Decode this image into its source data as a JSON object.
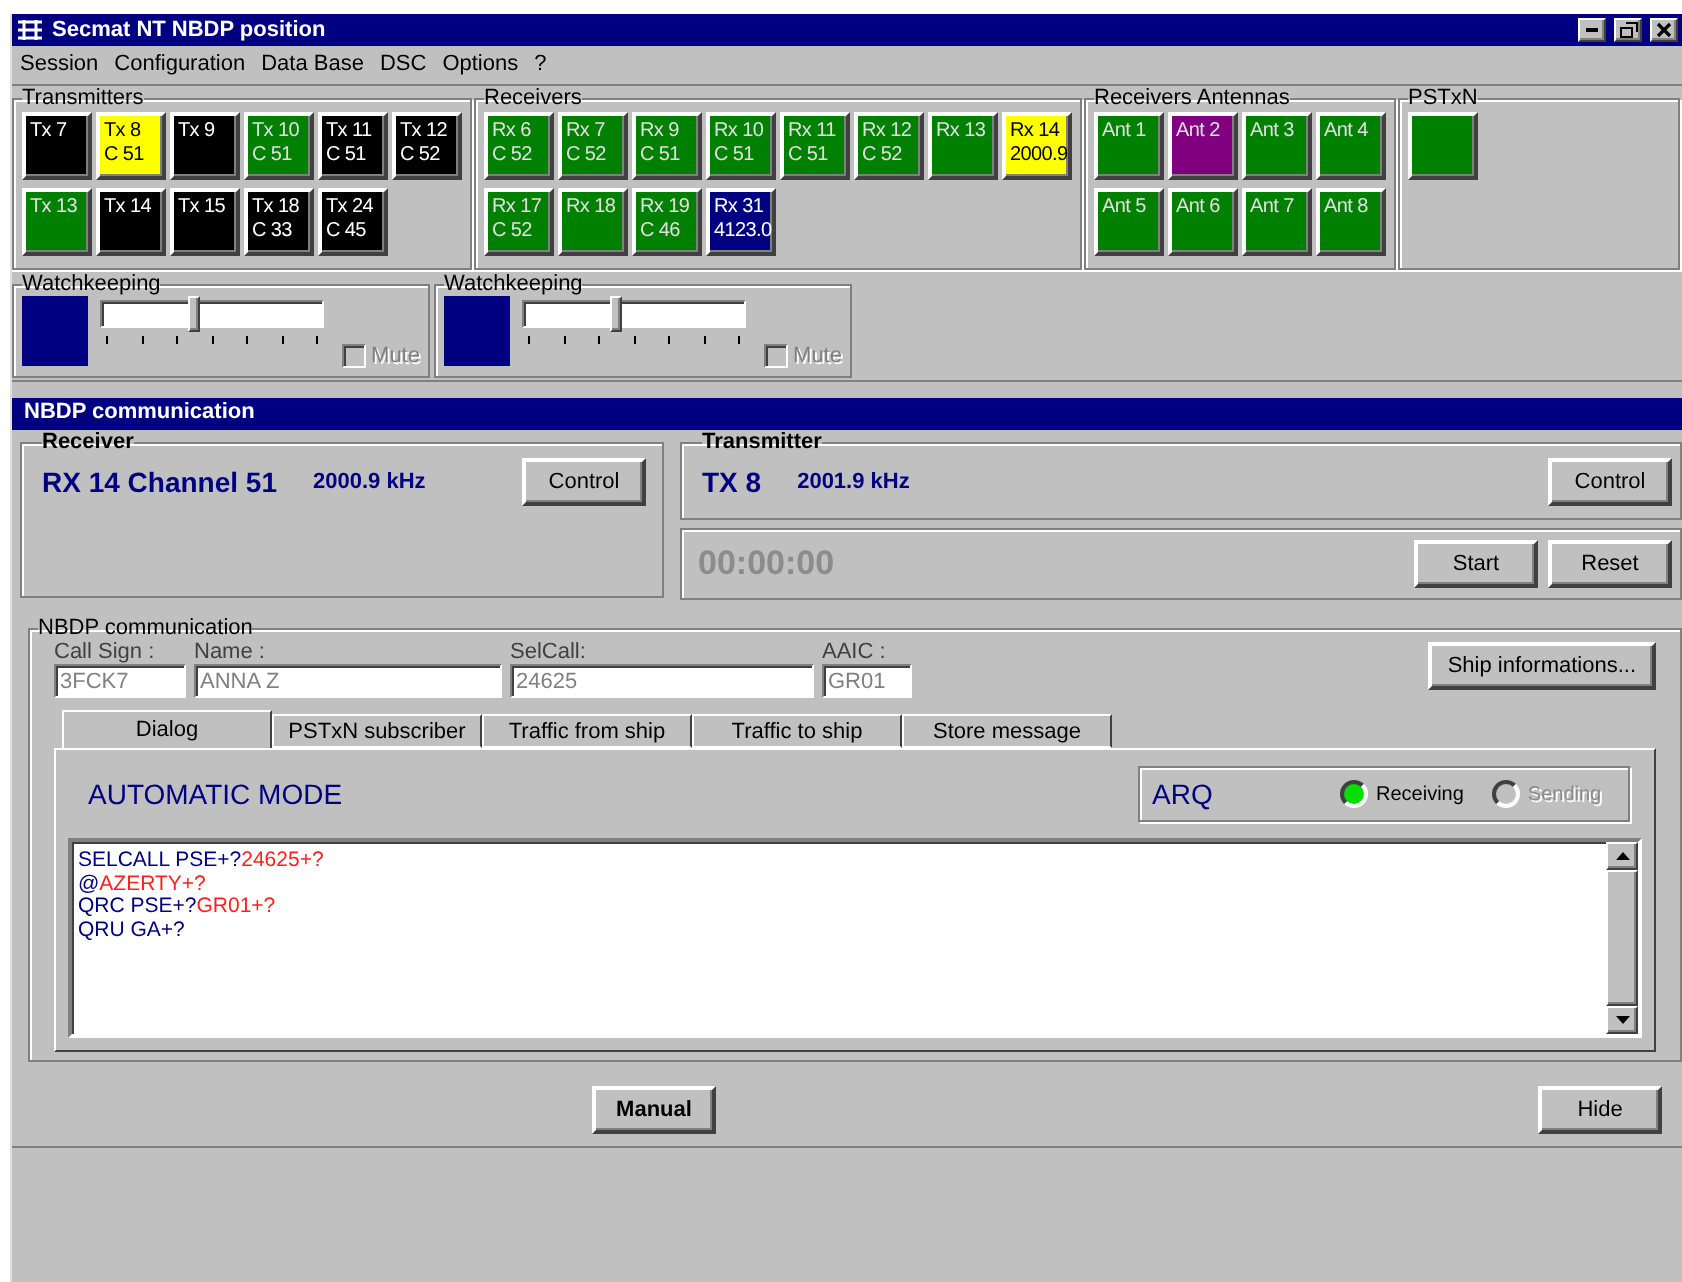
{
  "window": {
    "title": "Secmat NT NBDP position"
  },
  "menu": [
    "Session",
    "Configuration",
    "Data Base",
    "DSC",
    "Options",
    "?"
  ],
  "groups": [
    {
      "title": "Transmitters",
      "tiles": [
        {
          "lines": [
            "Tx 7"
          ],
          "color": "#000000"
        },
        {
          "lines": [
            "Tx 8",
            "C 51"
          ],
          "color": "#ffff00"
        },
        {
          "lines": [
            "Tx 9"
          ],
          "color": "#000000"
        },
        {
          "lines": [
            "Tx 10",
            "C 51"
          ],
          "color": "#008000"
        },
        {
          "lines": [
            "Tx 11",
            "C 51"
          ],
          "color": "#000000"
        },
        {
          "lines": [
            "Tx 12",
            "C 52"
          ],
          "color": "#000000"
        },
        {
          "lines": [
            "Tx 13"
          ],
          "color": "#008000"
        },
        {
          "lines": [
            "Tx 14"
          ],
          "color": "#000000"
        },
        {
          "lines": [
            "Tx 15"
          ],
          "color": "#000000"
        },
        {
          "lines": [
            "Tx 18",
            "C 33"
          ],
          "color": "#000000"
        },
        {
          "lines": [
            "Tx 24",
            "C 45"
          ],
          "color": "#000000"
        }
      ]
    },
    {
      "title": "Receivers",
      "tiles": [
        {
          "lines": [
            "Rx 6",
            "C 52"
          ],
          "color": "#008000"
        },
        {
          "lines": [
            "Rx 7",
            "C 52"
          ],
          "color": "#008000"
        },
        {
          "lines": [
            "Rx 9",
            "C 51"
          ],
          "color": "#008000"
        },
        {
          "lines": [
            "Rx 10",
            "C 51"
          ],
          "color": "#008000"
        },
        {
          "lines": [
            "Rx 11",
            "C 51"
          ],
          "color": "#008000"
        },
        {
          "lines": [
            "Rx 12",
            "C 52"
          ],
          "color": "#008000"
        },
        {
          "lines": [
            "Rx 13"
          ],
          "color": "#008000"
        },
        {
          "lines": [
            "Rx 14",
            "2000.9"
          ],
          "color": "#ffff00"
        },
        {
          "lines": [
            "Rx 17",
            "C 52"
          ],
          "color": "#008000"
        },
        {
          "lines": [
            "Rx 18"
          ],
          "color": "#008000"
        },
        {
          "lines": [
            "Rx 19",
            "C 46"
          ],
          "color": "#008000"
        },
        {
          "lines": [
            "Rx 31",
            "4123.0"
          ],
          "color": "#000080"
        }
      ]
    },
    {
      "title": "Receivers Antennas",
      "tiles": [
        {
          "lines": [
            "Ant 1"
          ],
          "color": "#008000"
        },
        {
          "lines": [
            "Ant 2"
          ],
          "color": "#800080"
        },
        {
          "lines": [
            "Ant 3"
          ],
          "color": "#008000"
        },
        {
          "lines": [
            "Ant 4"
          ],
          "color": "#008000"
        },
        {
          "lines": [
            "Ant 5"
          ],
          "color": "#008000"
        },
        {
          "lines": [
            "Ant 6"
          ],
          "color": "#008000"
        },
        {
          "lines": [
            "Ant 7"
          ],
          "color": "#008000"
        },
        {
          "lines": [
            "Ant 8"
          ],
          "color": "#008000"
        }
      ]
    },
    {
      "title": "PSTxN",
      "tiles": [
        {
          "color": "#008000"
        }
      ]
    }
  ],
  "watchkeeping": [
    {
      "title": "Watchkeeping",
      "level": 0.42,
      "mute": {
        "label": "Mute",
        "checked": false,
        "disabled": true
      }
    },
    {
      "title": "Watchkeeping",
      "level": 0.42,
      "mute": {
        "label": "Mute",
        "checked": false,
        "disabled": true
      }
    }
  ],
  "communication": {
    "title": "NBDP communication",
    "receiver": {
      "title": "Receiver",
      "channel": "RX 14 Channel 51",
      "frequency": "2000.9 kHz",
      "button": "Control"
    },
    "transmitter": {
      "title": "Transmitter",
      "channel": "TX 8",
      "frequency": "2001.9 kHz",
      "button": "Control",
      "timer": "00:00:00",
      "buttons": [
        "Start",
        "Reset"
      ]
    },
    "session": {
      "title": "NBDP communication",
      "fields": [
        {
          "label": "Call Sign :",
          "value": "3FCK7"
        },
        {
          "label": "Name :",
          "value": "ANNA Z"
        },
        {
          "label": "SelCall:",
          "value": "24625"
        },
        {
          "label": "AAIC :",
          "value": "GR01"
        }
      ],
      "ship_button": "Ship informations...",
      "tabs": [
        {
          "label": "Dialog",
          "selected": true
        },
        {
          "label": "PSTxN subscriber",
          "selected": false
        },
        {
          "label": "Traffic from ship",
          "selected": false
        },
        {
          "label": "Traffic to ship",
          "selected": false
        },
        {
          "label": "Store message",
          "selected": false
        }
      ],
      "mode": "AUTOMATIC MODE",
      "protocol": "ARQ",
      "indicators": [
        {
          "label": "Receiving",
          "on": true
        },
        {
          "label": "Sending",
          "on": false
        }
      ],
      "log": [
        [
          {
            "text": "SELCALL PSE+?",
            "kind": "sent"
          },
          {
            "text": "24625+?",
            "kind": "received"
          }
        ],
        [
          {
            "text": "@",
            "kind": "sent"
          },
          {
            "text": "AZERTY+?",
            "kind": "received"
          }
        ],
        [
          {
            "text": "QRC PSE+?",
            "kind": "sent"
          },
          {
            "text": "GR01+?",
            "kind": "received"
          }
        ],
        [
          {
            "text": "QRU GA+?",
            "kind": "sent"
          }
        ]
      ]
    },
    "buttons": [
      {
        "label": "Manual",
        "kind": "bold"
      },
      {
        "label": "Hide",
        "kind": "plain"
      }
    ]
  }
}
